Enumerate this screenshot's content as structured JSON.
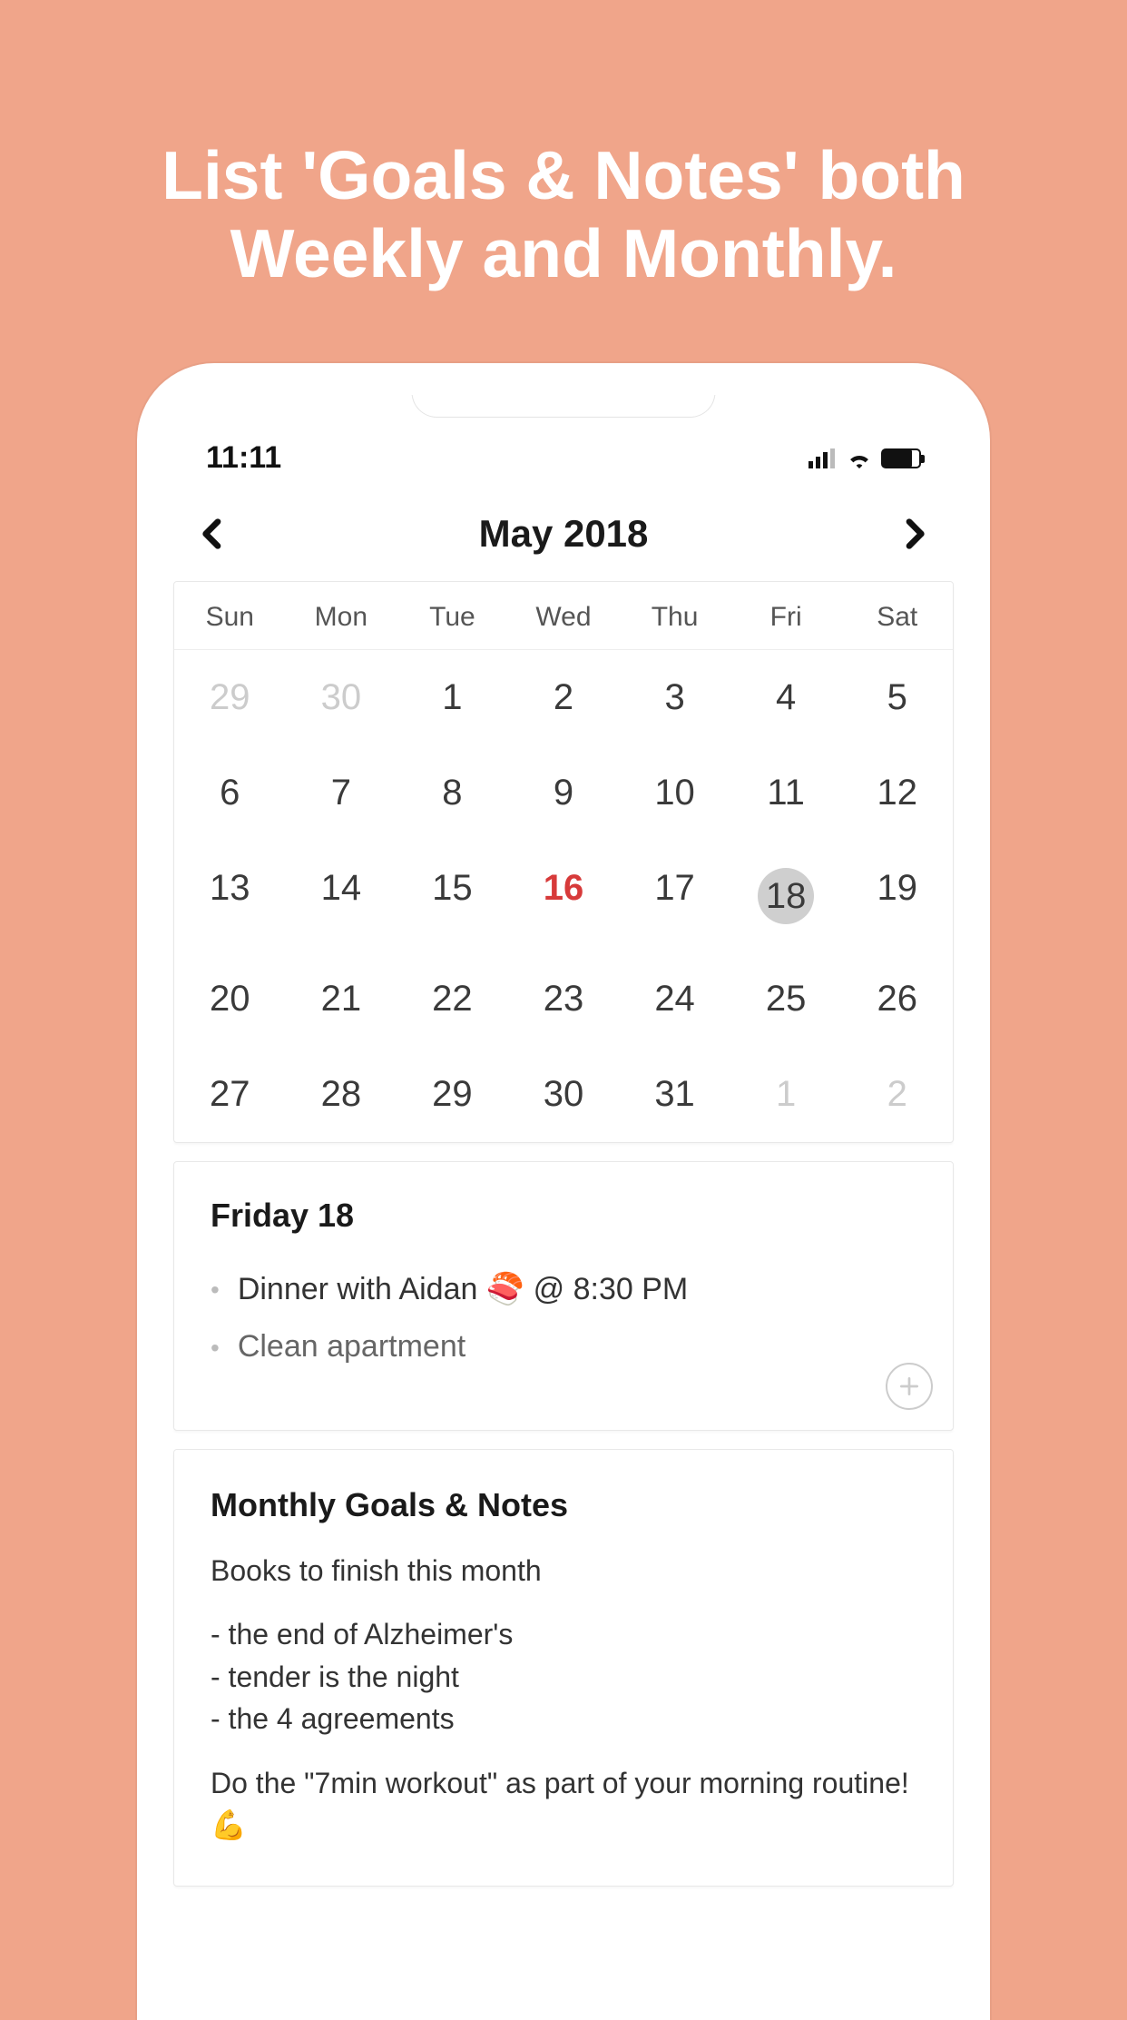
{
  "promo_line1": "List 'Goals & Notes' both",
  "promo_line2": "Weekly and Monthly.",
  "status": {
    "time": "11:11"
  },
  "calendar": {
    "month_title": "May 2018",
    "dow": [
      "Sun",
      "Mon",
      "Tue",
      "Wed",
      "Thu",
      "Fri",
      "Sat"
    ],
    "weeks": [
      [
        {
          "d": "29",
          "out": true
        },
        {
          "d": "30",
          "out": true
        },
        {
          "d": "1"
        },
        {
          "d": "2"
        },
        {
          "d": "3"
        },
        {
          "d": "4"
        },
        {
          "d": "5"
        }
      ],
      [
        {
          "d": "6"
        },
        {
          "d": "7"
        },
        {
          "d": "8"
        },
        {
          "d": "9"
        },
        {
          "d": "10"
        },
        {
          "d": "11"
        },
        {
          "d": "12"
        }
      ],
      [
        {
          "d": "13"
        },
        {
          "d": "14"
        },
        {
          "d": "15"
        },
        {
          "d": "16",
          "hl": true
        },
        {
          "d": "17"
        },
        {
          "d": "18",
          "sel": true
        },
        {
          "d": "19"
        }
      ],
      [
        {
          "d": "20"
        },
        {
          "d": "21"
        },
        {
          "d": "22"
        },
        {
          "d": "23"
        },
        {
          "d": "24"
        },
        {
          "d": "25"
        },
        {
          "d": "26"
        }
      ],
      [
        {
          "d": "27"
        },
        {
          "d": "28"
        },
        {
          "d": "29"
        },
        {
          "d": "30"
        },
        {
          "d": "31"
        },
        {
          "d": "1",
          "out": true
        },
        {
          "d": "2",
          "out": true
        }
      ]
    ]
  },
  "day": {
    "title": "Friday 18",
    "events": [
      "Dinner with Aidan 🍣 @ 8:30 PM",
      "Clean apartment"
    ]
  },
  "monthly": {
    "title": "Monthly Goals & Notes",
    "p1": "Books to finish this month",
    "list": [
      "- the end of Alzheimer's",
      "- tender is the night",
      "- the 4 agreements"
    ],
    "p2": "Do the \"7min workout\" as part of your morning routine! 💪"
  }
}
